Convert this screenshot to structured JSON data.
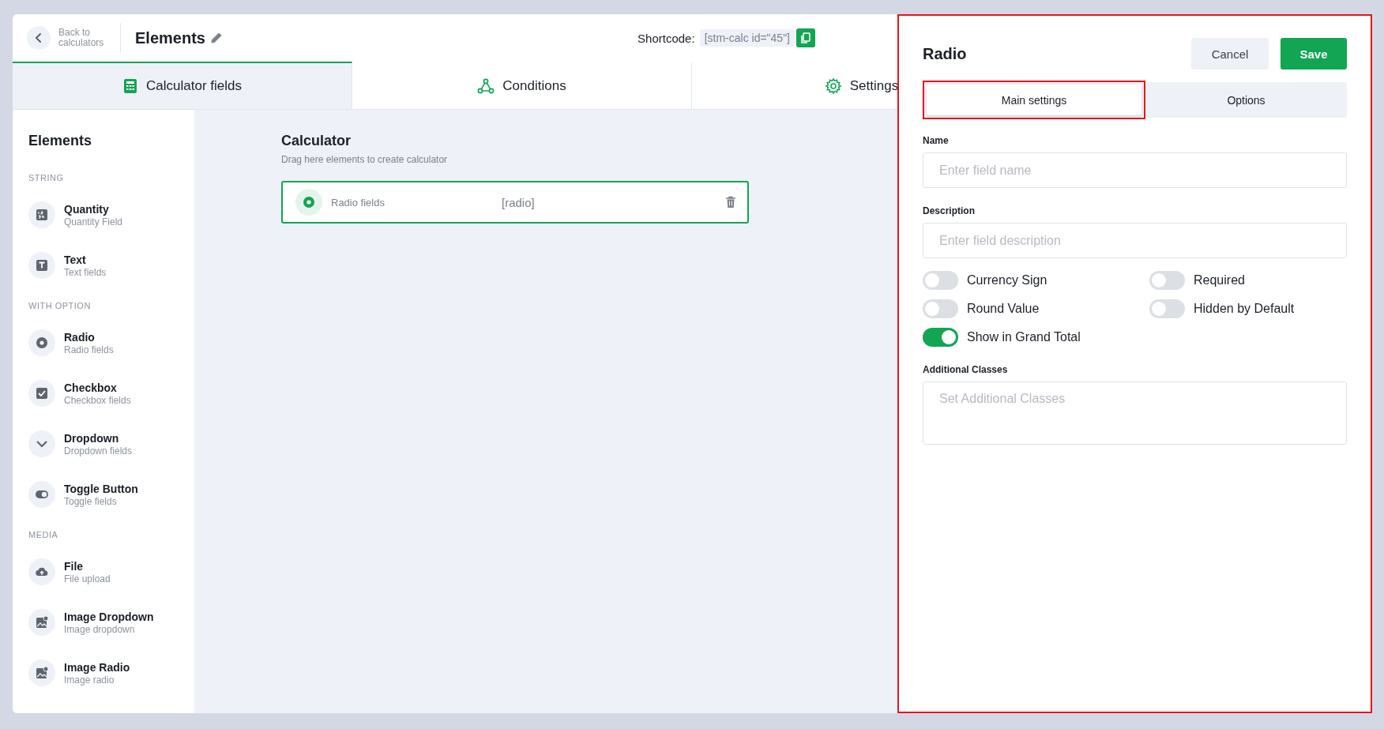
{
  "header": {
    "back_label": "Back to calculators",
    "title": "Elements",
    "shortcode_label": "Shortcode:",
    "shortcode": "[stm-calc id=\"45\"]"
  },
  "tabs": [
    {
      "label": "Calculator fields",
      "kind": "calculator",
      "selected": true
    },
    {
      "label": "Conditions",
      "kind": "conditions",
      "selected": false
    },
    {
      "label": "Settings",
      "kind": "settings",
      "selected": false
    }
  ],
  "sidebar": {
    "title": "Elements",
    "sections": [
      {
        "heading": "STRING",
        "items": [
          {
            "name": "Quantity",
            "subtitle": "Quantity Field",
            "kind": "quantity"
          },
          {
            "name": "Text",
            "subtitle": "Text fields",
            "kind": "text"
          }
        ]
      },
      {
        "heading": "WITH OPTION",
        "items": [
          {
            "name": "Radio",
            "subtitle": "Radio fields",
            "kind": "radio"
          },
          {
            "name": "Checkbox",
            "subtitle": "Checkbox fields",
            "kind": "checkbox"
          },
          {
            "name": "Dropdown",
            "subtitle": "Dropdown fields",
            "kind": "dropdown"
          },
          {
            "name": "Toggle Button",
            "subtitle": "Toggle fields",
            "kind": "toggle"
          }
        ]
      },
      {
        "heading": "MEDIA",
        "items": [
          {
            "name": "File",
            "subtitle": "File upload",
            "kind": "file"
          },
          {
            "name": "Image Dropdown",
            "subtitle": "Image dropdown",
            "kind": "image"
          },
          {
            "name": "Image Radio",
            "subtitle": "Image radio",
            "kind": "image"
          }
        ]
      }
    ]
  },
  "canvas": {
    "title": "Calculator",
    "hint": "Drag here elements to create calculator",
    "fields": [
      {
        "label": "Radio fields",
        "code": "[radio]",
        "kind": "radio",
        "selected": true
      }
    ]
  },
  "panel": {
    "title": "Radio",
    "highlighted": true,
    "buttons": [
      {
        "label": "Cancel",
        "kind": "secondary"
      },
      {
        "label": "Save",
        "kind": "primary"
      }
    ],
    "tabs": [
      {
        "label": "Main settings",
        "selected": true,
        "highlighted": true
      },
      {
        "label": "Options",
        "selected": false,
        "highlighted": false
      }
    ],
    "fields": [
      {
        "label": "Name",
        "placeholder": "Enter field name"
      },
      {
        "label": "Description",
        "placeholder": "Enter field description"
      }
    ],
    "toggles": [
      {
        "label": "Currency Sign",
        "on": false
      },
      {
        "label": "Required",
        "on": false
      },
      {
        "label": "Round Value",
        "on": false
      },
      {
        "label": "Hidden by Default",
        "on": false
      },
      {
        "label": "Show in Grand Total",
        "on": true
      }
    ],
    "classes": {
      "label": "Additional Classes",
      "placeholder": "Set Additional Classes"
    }
  }
}
